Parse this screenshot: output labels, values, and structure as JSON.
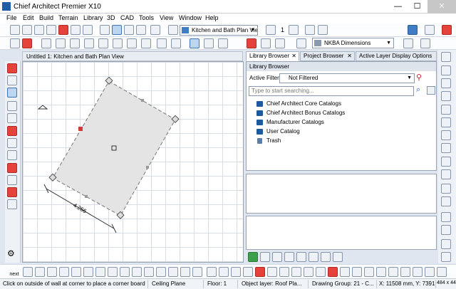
{
  "window": {
    "title": "Chief Architect Premier X10",
    "minimize": "—",
    "maximize": "☐",
    "close": "✕"
  },
  "menu": [
    "File",
    "Edit",
    "Build",
    "Terrain",
    "Library",
    "3D",
    "CAD",
    "Tools",
    "View",
    "Window",
    "Help"
  ],
  "toolbar": {
    "view_combo": "Kitchen and Bath Plan View",
    "floor_number": "1",
    "dimension_combo": "NKBA Dimensions"
  },
  "view_tab": {
    "label": "Untitled 1: Kitchen and Bath Plan View"
  },
  "plan": {
    "dimension_label": "4.266"
  },
  "right_tabs": [
    "Library Browser",
    "Project Browser",
    "Active Layer Display Options"
  ],
  "library": {
    "header": "Library Browser",
    "filter_label": "Active Filter:",
    "filter_value": "Not Filtered",
    "search_placeholder": "Type to start searching...",
    "items": [
      {
        "label": "Chief Architect Core Catalogs",
        "icon": "catalog-icon"
      },
      {
        "label": "Chief Architect Bonus Catalogs",
        "icon": "catalog-icon"
      },
      {
        "label": "Manufacturer Catalogs",
        "icon": "catalog-icon"
      },
      {
        "label": "User Catalog",
        "icon": "folder-icon"
      },
      {
        "label": "Trash",
        "icon": "trash-icon"
      }
    ]
  },
  "bottom": {
    "next_label": "next"
  },
  "status": {
    "hint": "Click on outside of wall at corner to place a corner board.",
    "plane": "Ceiling Plane",
    "floor": "Floor: 1",
    "layer": "Object layer: Roof Pla...",
    "group": "Drawing Group: 21 - C...",
    "coords": "X: 11508 mm, Y: 7391 m...",
    "size": "484 x 440"
  },
  "colors": {
    "accent": "#1c5fa8",
    "selected_handle": "#d23b35",
    "room_fill": "#e4e4e4"
  }
}
